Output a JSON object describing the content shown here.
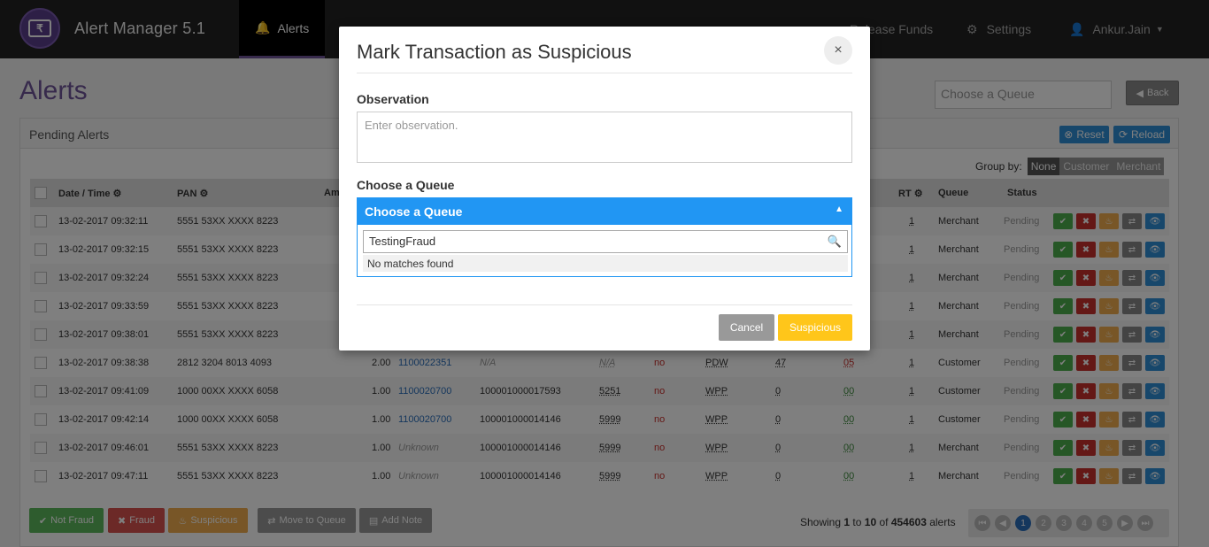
{
  "app": {
    "title": "Alert Manager 5.1"
  },
  "nav": {
    "items": [
      {
        "label": "Alerts",
        "icon": "bell-icon"
      },
      {
        "label": "Settings",
        "icon": "gear-icon"
      },
      {
        "label": "Ankur.Jain",
        "icon": "user-icon"
      }
    ],
    "release_funds": "Release Funds"
  },
  "page": {
    "title": "Alerts",
    "queue_placeholder": "Choose a Queue",
    "back_label": "Back"
  },
  "panel": {
    "title": "Pending Alerts",
    "reset_label": "Reset",
    "reload_label": "Reload"
  },
  "group_by": {
    "label": "Group by:",
    "options": [
      "None",
      "Customer",
      "Merchant"
    ],
    "selected": "None"
  },
  "table": {
    "headers": {
      "datetime": "Date / Time",
      "pan": "PAN",
      "amount": "Am",
      "rt": "RT",
      "queue": "Queue",
      "status": "Status"
    },
    "rows": [
      {
        "datetime": "13-02-2017 09:32:11",
        "pan": "5551 53XX XXXX 8223",
        "rt": "1",
        "queue": "Merchant",
        "status": "Pending"
      },
      {
        "datetime": "13-02-2017 09:32:15",
        "pan": "5551 53XX XXXX 8223",
        "rt": "1",
        "queue": "Merchant",
        "status": "Pending"
      },
      {
        "datetime": "13-02-2017 09:32:24",
        "pan": "5551 53XX XXXX 8223",
        "rt": "1",
        "queue": "Merchant",
        "status": "Pending"
      },
      {
        "datetime": "13-02-2017 09:33:59",
        "pan": "5551 53XX XXXX 8223",
        "rt": "1",
        "queue": "Merchant",
        "status": "Pending"
      },
      {
        "datetime": "13-02-2017 09:38:01",
        "pan": "5551 53XX XXXX 8223",
        "rt": "1",
        "queue": "Merchant",
        "status": "Pending"
      },
      {
        "datetime": "13-02-2017 09:38:38",
        "pan": "2812 3204 8013 4093",
        "amount": "2.00",
        "mid": "1100022351",
        "tid": "N/A",
        "mcc": "N/A",
        "flag": "no",
        "channel": "PDW",
        "c1": "47",
        "c2": "05",
        "rt": "1",
        "queue": "Customer",
        "status": "Pending"
      },
      {
        "datetime": "13-02-2017 09:41:09",
        "pan": "1000 00XX XXXX 6058",
        "amount": "1.00",
        "mid": "1100020700",
        "tid": "100001000017593",
        "mcc": "5251",
        "flag": "no",
        "channel": "WPP",
        "c1": "0",
        "c2": "00",
        "rt": "1",
        "queue": "Customer",
        "status": "Pending"
      },
      {
        "datetime": "13-02-2017 09:42:14",
        "pan": "1000 00XX XXXX 6058",
        "amount": "1.00",
        "mid": "1100020700",
        "tid": "100001000014146",
        "mcc": "5999",
        "flag": "no",
        "channel": "WPP",
        "c1": "0",
        "c2": "00",
        "rt": "1",
        "queue": "Customer",
        "status": "Pending"
      },
      {
        "datetime": "13-02-2017 09:46:01",
        "pan": "5551 53XX XXXX 8223",
        "amount": "1.00",
        "mid": "Unknown",
        "tid": "100001000014146",
        "mcc": "5999",
        "flag": "no",
        "channel": "WPP",
        "c1": "0",
        "c2": "00",
        "rt": "1",
        "queue": "Merchant",
        "status": "Pending"
      },
      {
        "datetime": "13-02-2017 09:47:11",
        "pan": "5551 53XX XXXX 8223",
        "amount": "1.00",
        "mid": "Unknown",
        "tid": "100001000014146",
        "mcc": "5999",
        "flag": "no",
        "channel": "WPP",
        "c1": "0",
        "c2": "00",
        "rt": "1",
        "queue": "Merchant",
        "status": "Pending"
      }
    ]
  },
  "footer": {
    "not_fraud": "Not Fraud",
    "fraud": "Fraud",
    "suspicious": "Suspicious",
    "move_to_queue": "Move to Queue",
    "add_note": "Add Note",
    "showing_prefix": "Showing",
    "from": "1",
    "to_word": "to",
    "to": "10",
    "of_word": "of",
    "total": "454603",
    "suffix": "alerts",
    "pages": [
      "1",
      "2",
      "3",
      "4",
      "5"
    ],
    "current_page": "1"
  },
  "modal": {
    "title": "Mark Transaction as Suspicious",
    "close": "×",
    "observation_label": "Observation",
    "observation_placeholder": "Enter observation.",
    "queue_label": "Choose a Queue",
    "queue_select": "Choose a Queue",
    "search_value": "TestingFraud",
    "no_matches": "No matches found",
    "cancel": "Cancel",
    "confirm": "Suspicious"
  },
  "colors": {
    "brand": "#6f5499",
    "primary": "#2196f3",
    "warning": "#ffc61a",
    "success": "#4cae4c",
    "danger": "#c9302c"
  }
}
